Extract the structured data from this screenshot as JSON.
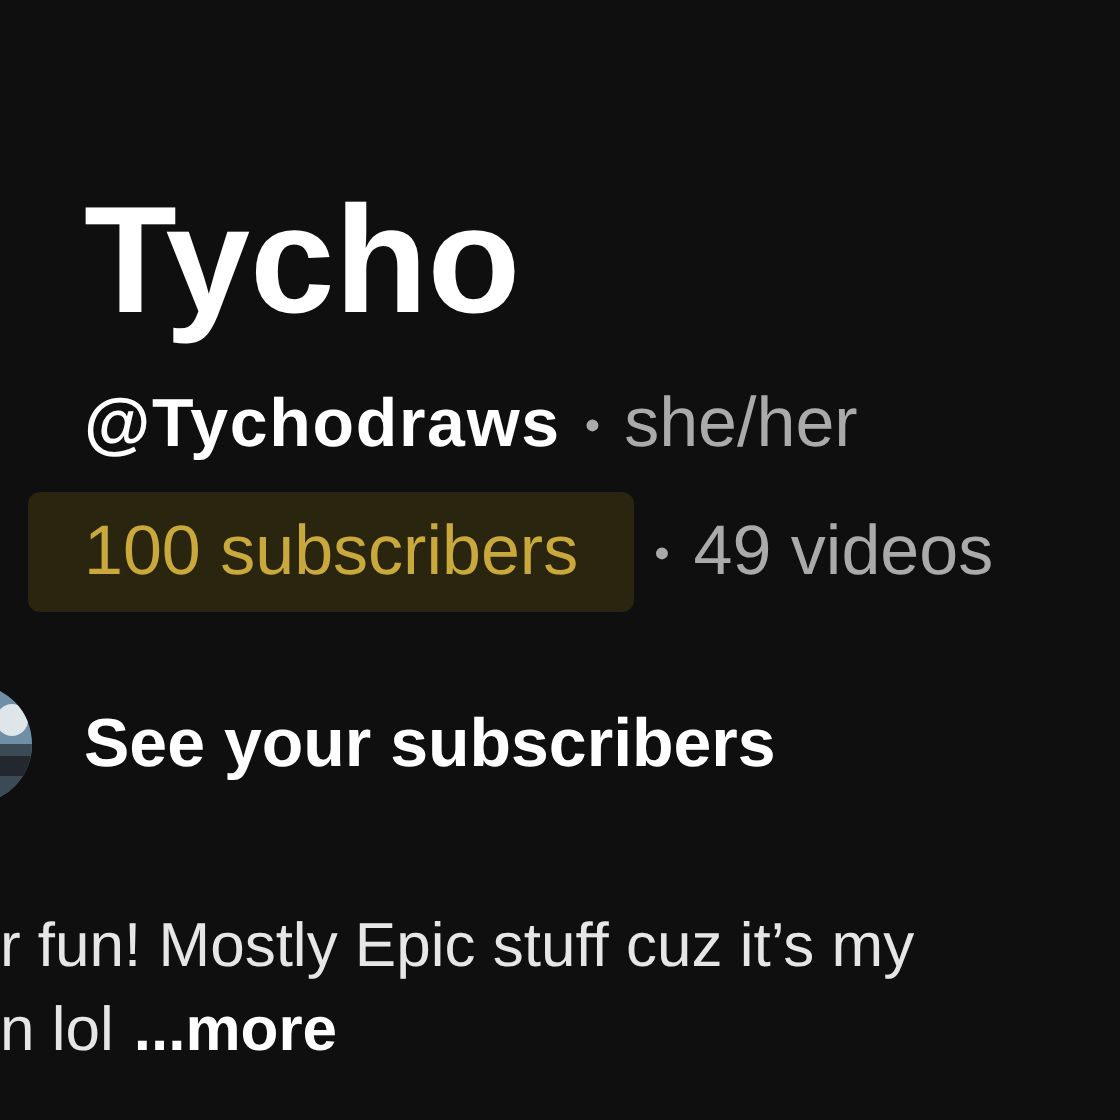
{
  "channel_name": "Tycho",
  "handle_row": [
    {
      "kind": "handle",
      "text": "@Tychodraws"
    },
    {
      "kind": "dot",
      "text": "•"
    },
    {
      "kind": "plain",
      "text": "she/her"
    }
  ],
  "stats_row": [
    {
      "kind": "plain",
      "text": "100 subscribers",
      "highlighted": true
    },
    {
      "kind": "dot",
      "text": "•",
      "highlighted": false
    },
    {
      "kind": "plain",
      "text": "49 videos",
      "highlighted": false
    }
  ],
  "subscribers_link": {
    "label": "See your subscribers"
  },
  "description": {
    "lines": [
      "r fun! Mostly Epic stuff cuz it’s my",
      "n lol"
    ],
    "more": "...more"
  }
}
